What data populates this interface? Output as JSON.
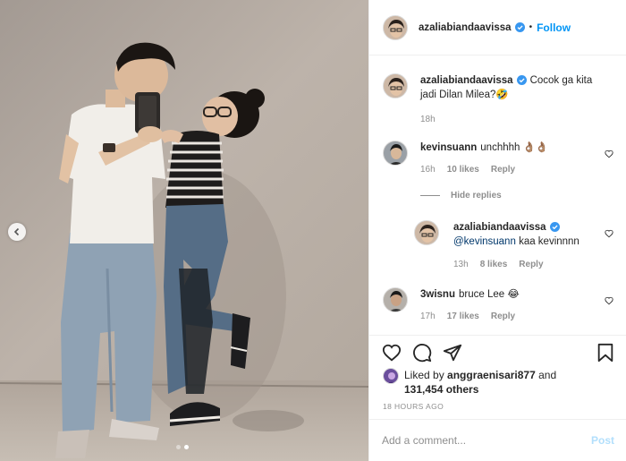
{
  "post": {
    "author": "azaliabiandaavissa",
    "follow_label": "Follow",
    "separator": "•",
    "caption": {
      "username": "azaliabiandaavissa",
      "text": "Cocok ga kita jadi Dilan Milea?🤣",
      "time": "18h"
    }
  },
  "comments": [
    {
      "username": "kevinsuann",
      "text": "unchhhh 👌🏽👌🏽",
      "time": "16h",
      "likes": "10 likes",
      "reply_label": "Reply"
    },
    {
      "username": "3wisnu",
      "text": "bruce Lee 😂",
      "time": "17h",
      "likes": "17 likes",
      "reply_label": "Reply"
    }
  ],
  "hide_replies_label": "Hide replies",
  "reply": {
    "username": "azaliabiandaavissa",
    "mention": "@kevinsuann",
    "text": "kaa kevinnnn",
    "time": "13h",
    "likes": "8 likes",
    "reply_label": "Reply"
  },
  "likes_info": {
    "prefix": "Liked by",
    "user": "anggraenisari877",
    "and": "and",
    "count": "131,454 others"
  },
  "timestamp": "18 HOURS AGO",
  "comment_box": {
    "placeholder": "Add a comment...",
    "post_label": "Post"
  },
  "carousel": {
    "current": 2,
    "total": 2
  },
  "colors": {
    "accent": "#0095f6",
    "muted": "#8e8e8e",
    "verified": "#3897f0"
  },
  "icons": [
    "verified-icon",
    "heart-icon",
    "comment-icon",
    "share-icon",
    "bookmark-icon",
    "chevron-left-icon",
    "small-heart-icon"
  ]
}
